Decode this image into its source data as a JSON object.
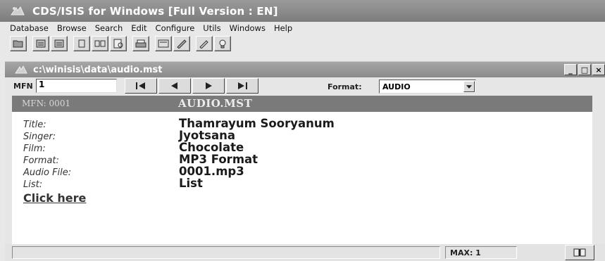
{
  "app": {
    "title": "CDS/ISIS for Windows [Full Version : EN]"
  },
  "menu": [
    {
      "label": "Database"
    },
    {
      "label": "Browse"
    },
    {
      "label": "Search"
    },
    {
      "label": "Edit"
    },
    {
      "label": "Configure"
    },
    {
      "label": "Utils"
    },
    {
      "label": "Windows"
    },
    {
      "label": "Help"
    }
  ],
  "toolbar": {
    "icons": [
      "open-folder-icon",
      "print-db-icon",
      "print-db-2-icon",
      "record-icon",
      "records-icon",
      "browse-icon",
      "printer-icon",
      "form-icon",
      "edit-icon",
      "pencil-icon",
      "help-bulb-icon"
    ]
  },
  "window": {
    "title": "c:\\winisis\\data\\audio.mst",
    "controls": {
      "minimize": "_",
      "maximize": "□",
      "close": "×"
    }
  },
  "nav": {
    "mfn_label": "MFN",
    "mfn_value": "1",
    "format_label": "Format:",
    "format_value": "AUDIO"
  },
  "record": {
    "mfn_header": "MFN: 0001",
    "db_name": "AUDIO.MST",
    "fields": [
      {
        "label": "Title:",
        "value": "Thamrayum Sooryanum"
      },
      {
        "label": "Singer:",
        "value": "Jyotsana"
      },
      {
        "label": "Film:",
        "value": "Chocolate"
      },
      {
        "label": "Format:",
        "value": "MP3 Format"
      },
      {
        "label": "Audio File:",
        "value": "0001.mp3"
      },
      {
        "label": "List:",
        "value": "List"
      }
    ],
    "link": "Click here"
  },
  "status": {
    "message": "",
    "max": "MAX: 1"
  },
  "colors": {
    "title_bar": "#8a8a8a",
    "record_header": "#7a7a7a",
    "record_body": "#ffffff"
  }
}
